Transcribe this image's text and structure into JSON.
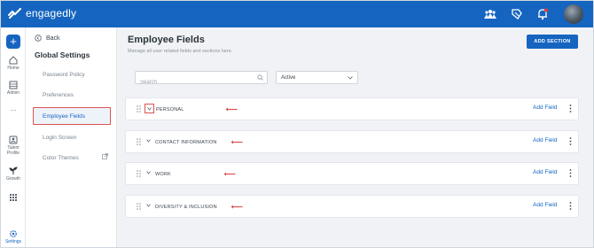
{
  "app": {
    "name": "engagedly",
    "brand_color": "#1565c0"
  },
  "topbar": {
    "icons": [
      "teams-icon",
      "recognition-icon",
      "bell-icon"
    ],
    "avatar": "user-avatar"
  },
  "rail": {
    "add_label": "+",
    "items": [
      {
        "label": "Home",
        "icon": "home-icon"
      },
      {
        "label": "Admin",
        "icon": "admin-icon"
      },
      {
        "label": "...",
        "icon": "more-icon"
      },
      {
        "label": "Talent Profile",
        "icon": "talent-profile-icon"
      },
      {
        "label": "Growth",
        "icon": "growth-icon"
      },
      {
        "label": "",
        "icon": "apps-grid-icon"
      },
      {
        "label": "Settings",
        "icon": "settings-icon"
      }
    ]
  },
  "sidebar": {
    "back_label": "Back",
    "title": "Global Settings",
    "items": [
      {
        "label": "Password Policy"
      },
      {
        "label": "Preferences"
      },
      {
        "label": "Employee Fields"
      },
      {
        "label": "Login Screen"
      },
      {
        "label": "Color Themes"
      }
    ],
    "active": "Employee Fields"
  },
  "main": {
    "title": "Employee Fields",
    "subtitle": "Manage all user related fields and sections here.",
    "add_section_label": "ADD SECTION",
    "search_placeholder": "Search",
    "status_value": "Active",
    "sections": [
      {
        "name": "PERSONAL",
        "action": "Add Field"
      },
      {
        "name": "CONTACT INFORMATION",
        "action": "Add Field"
      },
      {
        "name": "WORK",
        "action": "Add Field"
      },
      {
        "name": "DIVERSITY & INCLUSION",
        "action": "Add Field"
      }
    ]
  },
  "annotation_color": "#d9534f"
}
